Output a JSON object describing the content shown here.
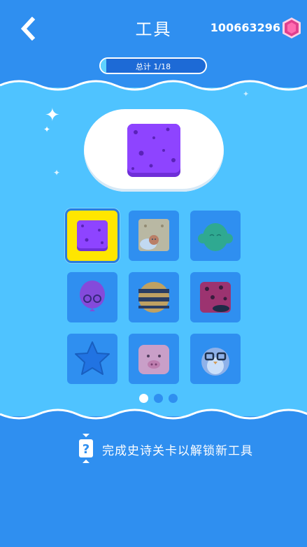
{
  "header": {
    "title": "工具",
    "gem_count": "100663296",
    "icons": {
      "back": "back-chevron-icon",
      "gem": "gem-icon"
    }
  },
  "progress": {
    "label": "总计 1/18",
    "fraction": 0.056
  },
  "preview": {
    "item": "purple-sponge"
  },
  "tools": [
    {
      "name": "purple-sponge",
      "selected": true
    },
    {
      "name": "cracker-with-cat",
      "selected": false
    },
    {
      "name": "green-cactus",
      "selected": false
    },
    {
      "name": "purple-balloon-glasses",
      "selected": false
    },
    {
      "name": "striped-ball",
      "selected": false
    },
    {
      "name": "ladybug-cube",
      "selected": false
    },
    {
      "name": "blue-star",
      "selected": false
    },
    {
      "name": "pink-pig",
      "selected": false
    },
    {
      "name": "bird-with-glasses",
      "selected": false
    }
  ],
  "pagination": {
    "pages": 3,
    "current": 0
  },
  "footer": {
    "text": "完成史诗关卡以解锁新工具",
    "icon": "unlock-hint-icon"
  },
  "colors": {
    "top_bg": "#2f8ff0",
    "mid_bg": "#4fc3ff",
    "selected_bg": "#ffe600",
    "gem": "#e0408f"
  }
}
